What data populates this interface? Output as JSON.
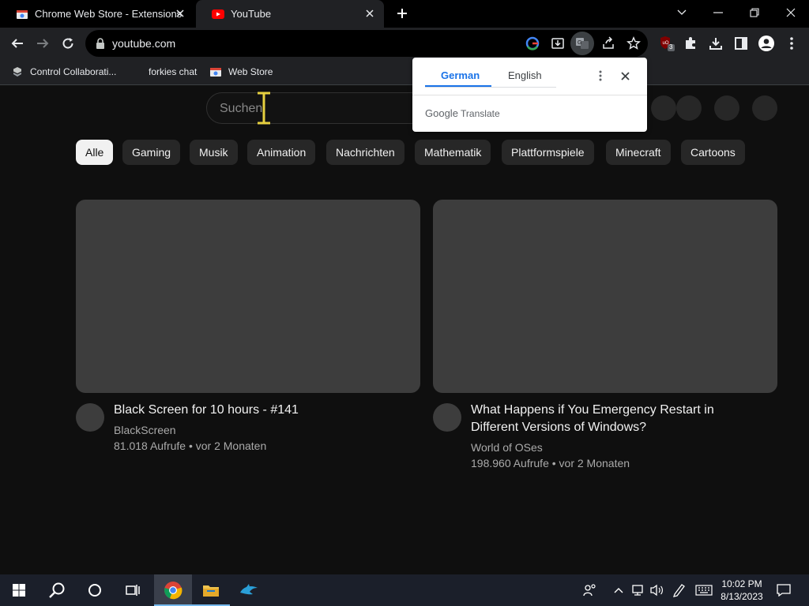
{
  "browser": {
    "tabs": [
      {
        "title": "Chrome Web Store - Extensions",
        "favicon": "chrome-web-store-icon"
      },
      {
        "title": "YouTube",
        "favicon": "youtube-icon",
        "active": true
      }
    ],
    "url": "youtube.com",
    "extension_badge": "3",
    "bookmarks": [
      {
        "label": "Control Collaborati...",
        "icon": "extension-icon"
      },
      {
        "label": "forkies chat",
        "icon": "none"
      },
      {
        "label": "Web Store",
        "icon": "chrome-web-store-icon"
      }
    ]
  },
  "translate_popup": {
    "source_language": "German",
    "target_language": "English",
    "brand_google": "Google",
    "brand_translate": "Translate"
  },
  "youtube": {
    "search_placeholder": "Suchen",
    "chips": [
      "Alle",
      "Gaming",
      "Musik",
      "Animation",
      "Nachrichten",
      "Mathematik",
      "Plattformspiele",
      "Minecraft",
      "Cartoons"
    ],
    "videos": [
      {
        "title": "Black Screen for 10 hours - #141",
        "channel": "BlackScreen",
        "meta": "81.018 Aufrufe • vor 2 Monaten"
      },
      {
        "title": "What Happens if You Emergency Restart in Different Versions of Windows?",
        "channel": "World of OSes",
        "meta": "198.960 Aufrufe • vor 2 Monaten"
      }
    ]
  },
  "taskbar": {
    "time": "10:02 PM",
    "date": "8/13/2023"
  },
  "colors": {
    "page_bg": "#0f0f0f",
    "chrome_toolbar": "#202124",
    "accent_blue": "#1a73e8",
    "youtube_red": "#ff0000"
  }
}
